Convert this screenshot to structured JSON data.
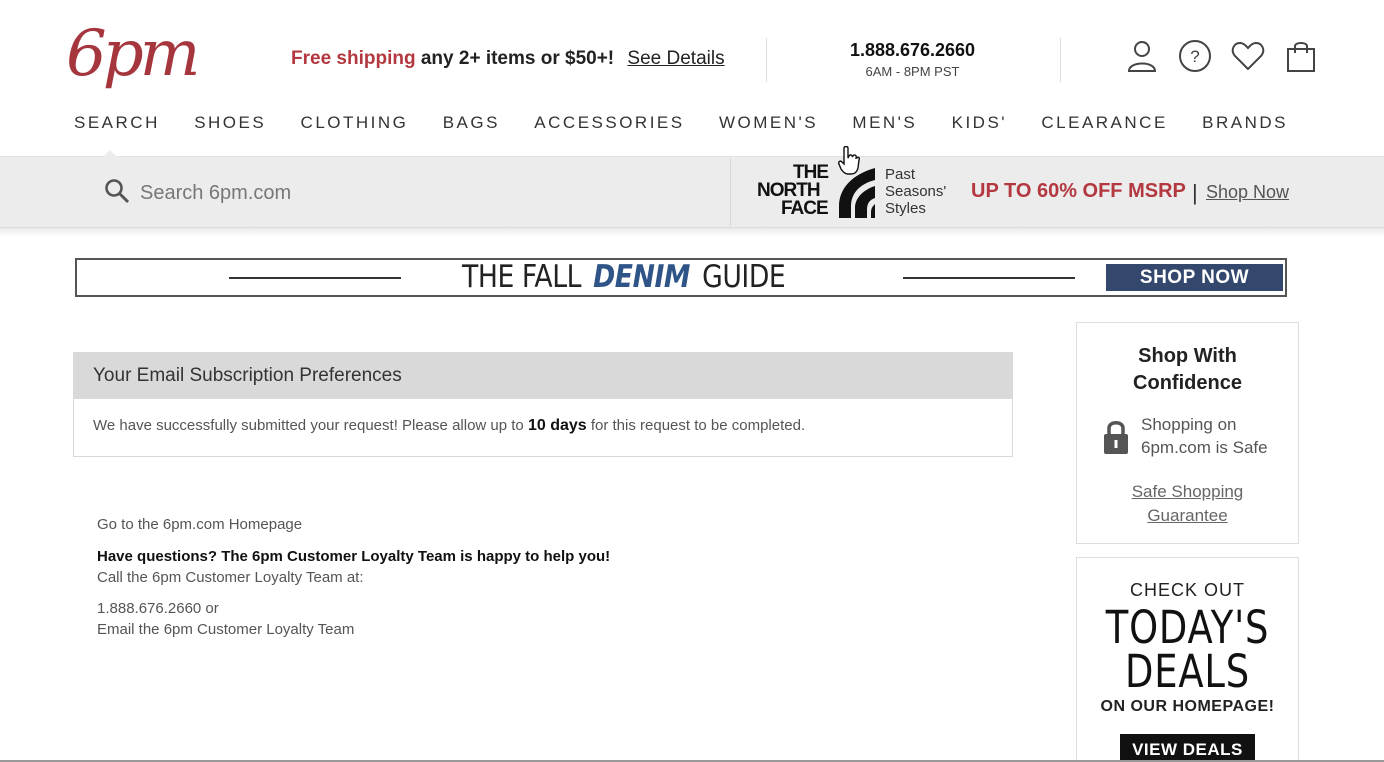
{
  "header": {
    "logo": "6pm",
    "promo": {
      "highlight": "Free shipping",
      "rest": " any 2+ items or $50+!",
      "details_link": "See Details"
    },
    "phone": {
      "number": "1.888.676.2660",
      "hours": "6AM - 8PM PST"
    },
    "icons": [
      "account-icon",
      "help-icon",
      "heart-icon",
      "shopping-bag-icon"
    ]
  },
  "nav": {
    "items": [
      "SEARCH",
      "SHOES",
      "CLOTHING",
      "BAGS",
      "ACCESSORIES",
      "WOMEN'S",
      "MEN'S",
      "KIDS'",
      "CLEARANCE",
      "BRANDS"
    ]
  },
  "search": {
    "placeholder": "Search 6pm.com"
  },
  "promo_band": {
    "brand_line1": "THE",
    "brand_line2": "NORTH",
    "brand_line3": "FACE",
    "brand_sub": [
      "Past",
      "Seasons'",
      "Styles"
    ],
    "deal": "UP TO 60% OFF MSRP",
    "separator": "|",
    "shop_link": "Shop Now"
  },
  "denim_banner": {
    "pre": "THE FALL",
    "highlight": "DENIM",
    "post": "GUIDE",
    "button": "SHOP NOW"
  },
  "preferences": {
    "title": "Your Email Subscription Preferences",
    "message_pre": "We have successfully submitted your request! Please allow up to ",
    "message_bold": "10 days",
    "message_post": " for this request to be completed."
  },
  "help": {
    "home_link": "Go to the 6pm.com Homepage",
    "question": "Have questions? The 6pm Customer Loyalty Team is happy to help you!",
    "call_text": "Call the 6pm Customer Loyalty Team at:",
    "phone": "1.888.676.2660 or",
    "email_link": "Email the 6pm Customer Loyalty Team"
  },
  "confidence_card": {
    "title_line1": "Shop With",
    "title_line2": "Confidence",
    "safe_line1": "Shopping on",
    "safe_line2": "6pm.com is Safe",
    "link_line1": "Safe Shopping",
    "link_line2": "Guarantee"
  },
  "deals_card": {
    "check_out": "CHECK OUT",
    "today": "TODAY'S",
    "deals": "DEALS",
    "on_homepage": "ON OUR HOMEPAGE!",
    "button": "VIEW DEALS"
  },
  "colors": {
    "brand_red": "#b3383f",
    "denim_blue": "#2f5487",
    "shop_now_bg": "#34476c",
    "band_gray": "#ececec"
  }
}
